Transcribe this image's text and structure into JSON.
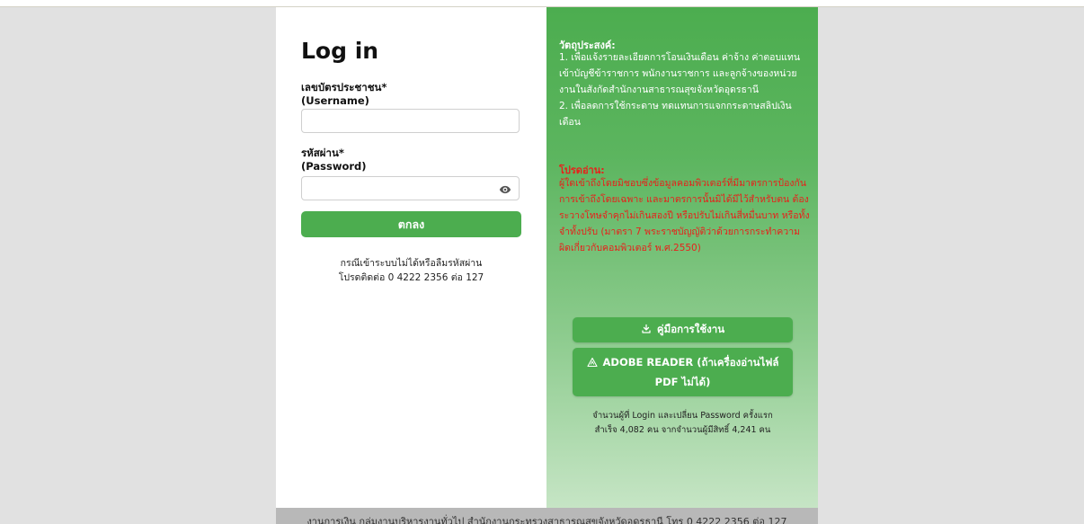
{
  "login": {
    "title": "Log in",
    "username_label": "เลขบัตรประชาชน*",
    "username_sub": "(Username)",
    "username_value": "",
    "password_label": "รหัสผ่าน*",
    "password_sub": "(Password)",
    "password_value": "",
    "submit_label": "ตกลง",
    "help_line1": "กรณีเข้าระบบไม่ได้หรือลืมรหัสผ่าน",
    "help_line2": "โปรดติดต่อ 0 4222 2356 ต่อ 127"
  },
  "info": {
    "objective_title": "วัตถุประสงค์:",
    "objective_1": "1. เพื่อแจ้งรายละเอียดการโอนเงินเดือน ค่าจ้าง ค่าตอบแทนเข้าบัญชีข้าราชการ พนักงานราชการ และลูกจ้างของหน่วยงานในสังกัดสำนักงานสาธารณสุขจังหวัดอุดรธานี",
    "objective_2": "2. เพื่อลดการใช้กระดาษ ทดแทนการแจกกระดาษสลิปเงินเดือน",
    "warning_title": "โปรดอ่าน:",
    "warning_text": "ผู้ใดเข้าถึงโดยมิชอบซึ่งข้อมูลคอมพิวเตอร์ที่มีมาตรการป้องกันการเข้าถึงโดยเฉพาะ และมาตรการนั้นมิได้มีไว้สำหรับตน ต้องระวางโทษจำคุกไม่เกินสองปี หรือปรับไม่เกินสี่หมื่นบาท หรือทั้งจำทั้งปรับ (มาตรา 7 พระราชบัญญัติว่าด้วยการกระทำความผิดเกี่ยวกับคอมพิวเตอร์ พ.ศ.2550)",
    "manual_label": "คู่มือการใช้งาน",
    "adobe_label": "ADOBE READER (ถ้าเครื่องอ่านไฟล์ PDF ไม่ได้)",
    "stats_line1": "จำนวนผู้ที่ Login และเปลี่ยน Password ครั้งแรก",
    "stats_line2": "สำเร็จ 4,082 คน จากจำนวนผู้มีสิทธิ์ 4,241 คน"
  },
  "footer": {
    "text": "งานการเงิน กลุ่มงานบริหารงานทั่วไป สำนักงานกระทรวงสาธารณสุขจังหวัดอุดรธานี โทร 0 4222 2356 ต่อ 127"
  },
  "icons": {
    "eye": "eye-icon",
    "download": "download-icon",
    "warning": "warning-triangle-icon"
  },
  "colors": {
    "accent": "#4cad4f",
    "warning": "#e8201a",
    "background": "#e1e1e1"
  }
}
